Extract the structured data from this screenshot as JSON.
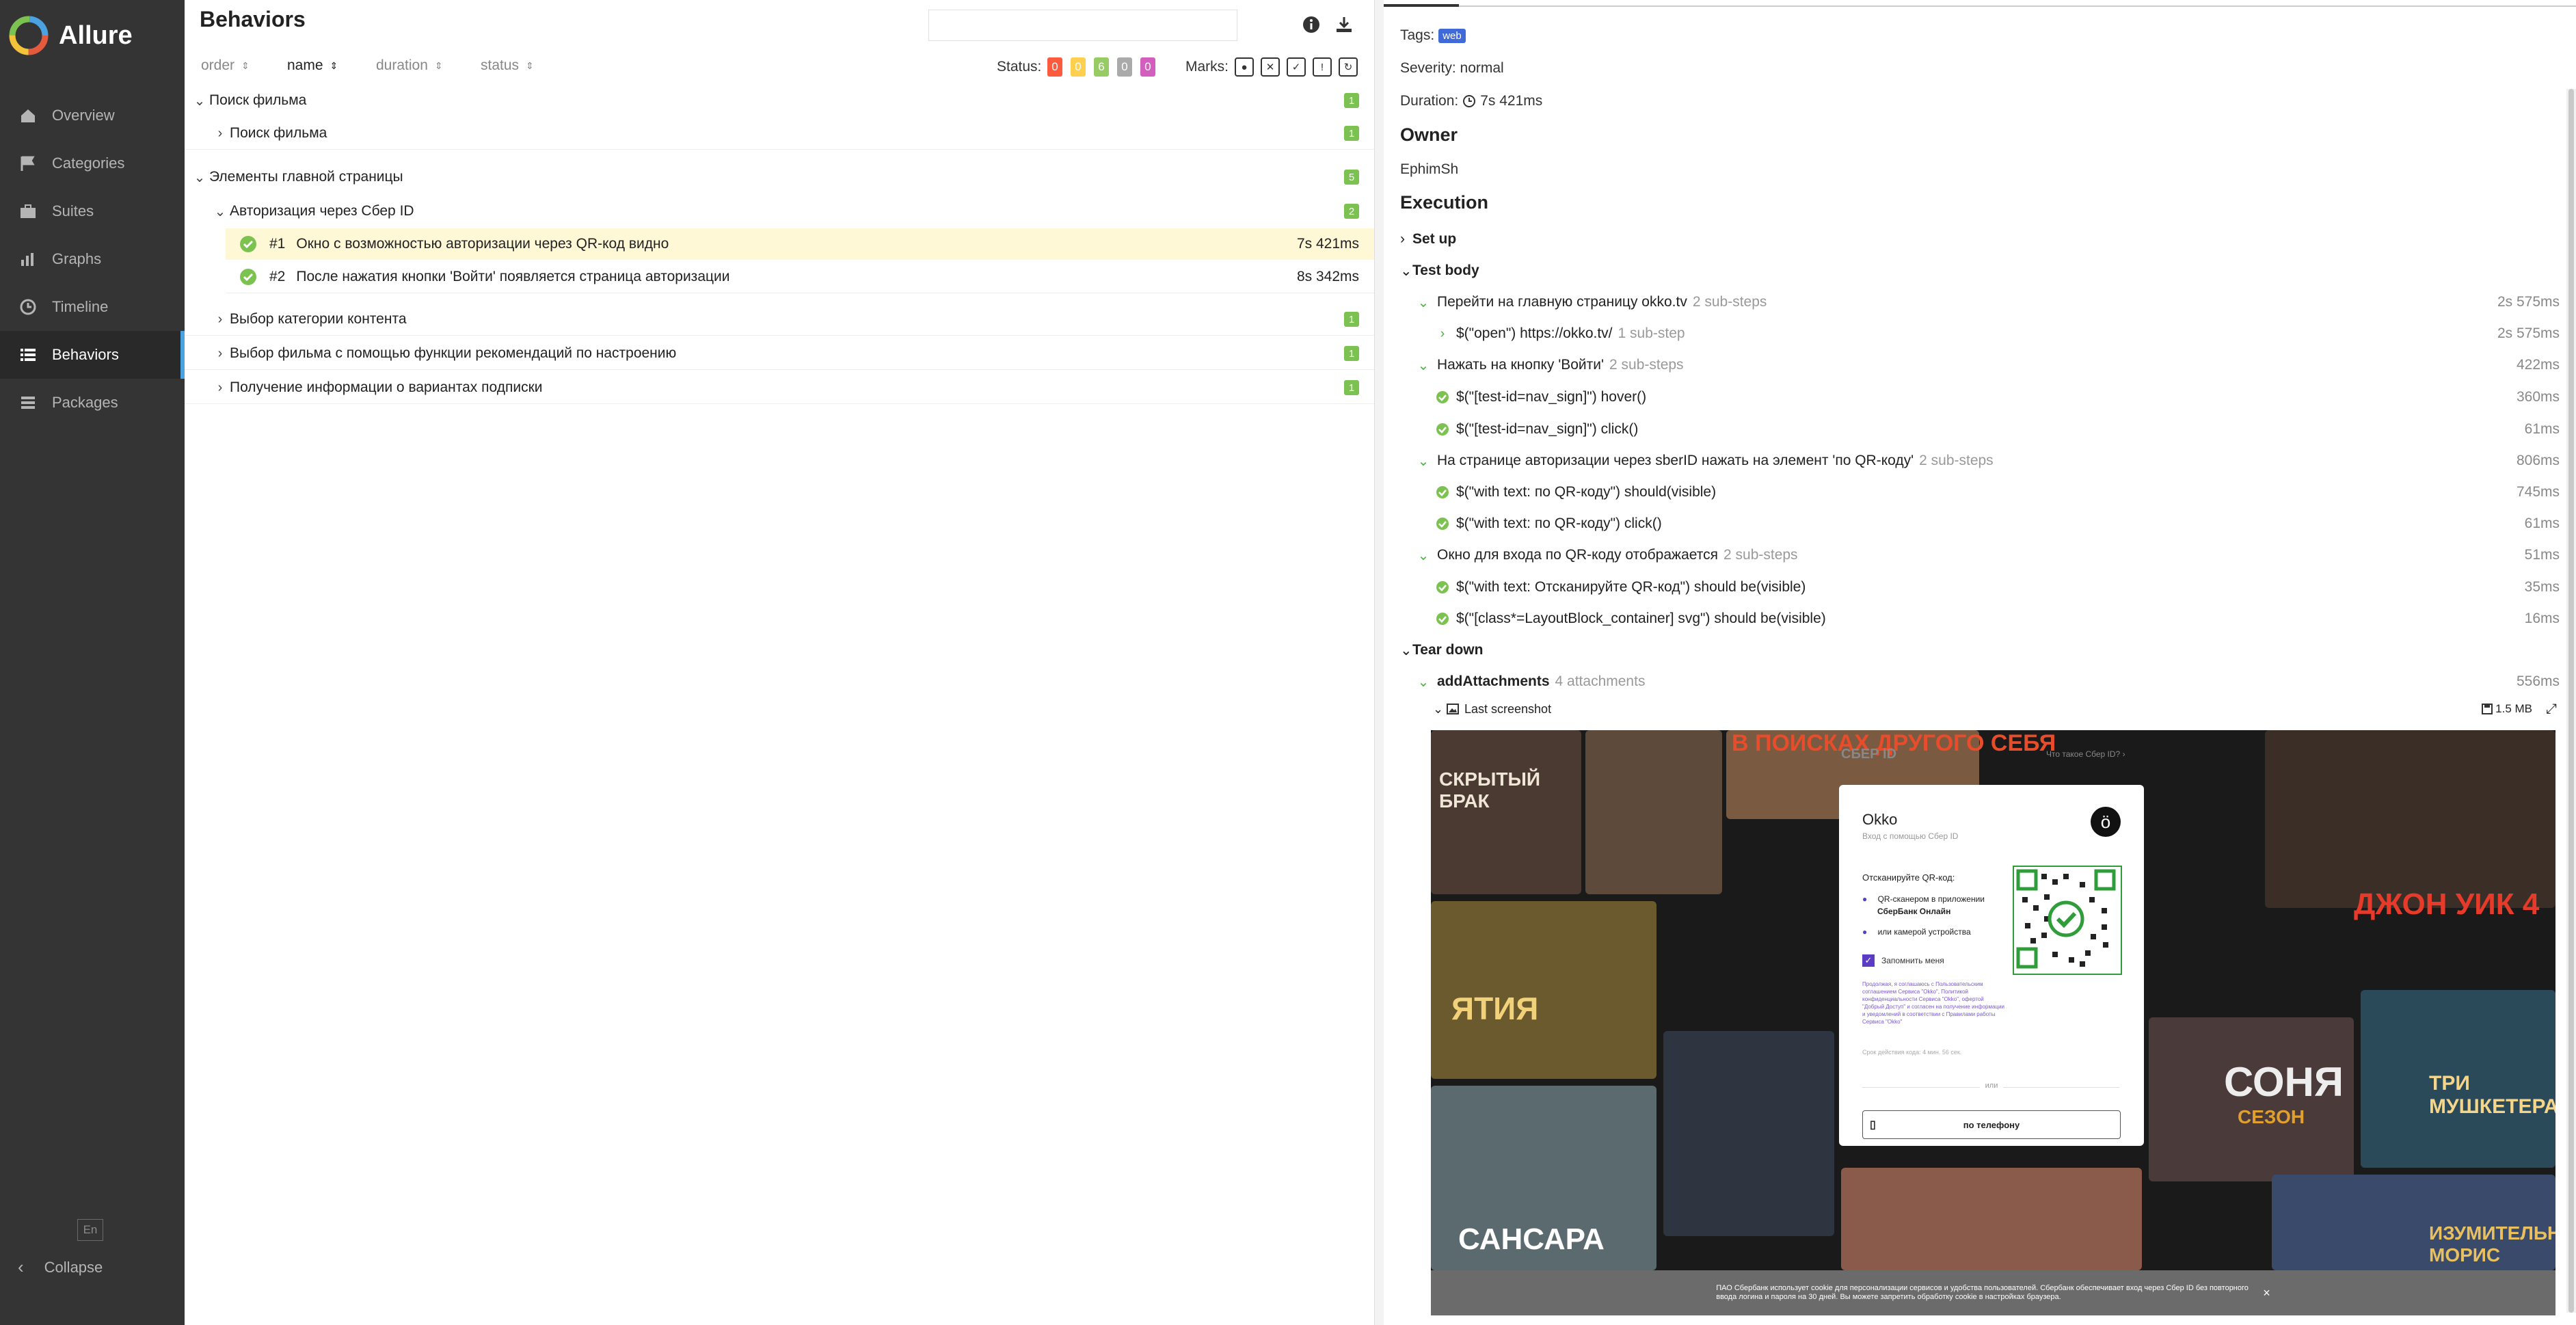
{
  "sidebar": {
    "brand": "Allure",
    "items": [
      {
        "label": "Overview",
        "icon": "overview-icon"
      },
      {
        "label": "Categories",
        "icon": "flag-icon"
      },
      {
        "label": "Suites",
        "icon": "briefcase-icon"
      },
      {
        "label": "Graphs",
        "icon": "bar-chart-icon"
      },
      {
        "label": "Timeline",
        "icon": "clock-icon"
      },
      {
        "label": "Behaviors",
        "icon": "list-icon",
        "active": true
      },
      {
        "label": "Packages",
        "icon": "stack-icon"
      }
    ],
    "lang": "En",
    "collapse": "Collapse"
  },
  "list": {
    "title": "Behaviors",
    "sort": {
      "order": "order",
      "name": "name",
      "duration": "duration",
      "status": "status"
    },
    "status_label": "Status:",
    "status_counts": [
      {
        "value": "0",
        "color": "#fd5a3e"
      },
      {
        "value": "0",
        "color": "#ffd050"
      },
      {
        "value": "6",
        "color": "#97cc64"
      },
      {
        "value": "0",
        "color": "#aaaaaa"
      },
      {
        "value": "0",
        "color": "#d35ebe"
      }
    ],
    "marks_label": "Marks:",
    "rows": [
      {
        "label": "Поиск фильма",
        "count": "1"
      },
      {
        "label": "Поиск фильма",
        "count": "1"
      },
      {
        "label": "Элементы главной страницы",
        "count": "5"
      },
      {
        "label": "Авторизация через Сбер ID",
        "count": "2"
      },
      {
        "num": "#1",
        "label": "Окно с возможностью авторизации через QR-код видно",
        "duration": "7s 421ms"
      },
      {
        "num": "#2",
        "label": "После нажатия кнопки 'Войти' появляется страница авторизации",
        "duration": "8s 342ms"
      },
      {
        "label": "Выбор категории контента",
        "count": "1"
      },
      {
        "label": "Выбор фильма с помощью функции рекомендаций по настроению",
        "count": "1"
      },
      {
        "label": "Получение информации о вариантах подписки",
        "count": "1"
      }
    ]
  },
  "detail": {
    "tags_label": "Tags:",
    "tag": "web",
    "severity": "Severity: normal",
    "duration_label": "Duration:",
    "duration": "7s 421ms",
    "owner_title": "Owner",
    "owner": "EphimSh",
    "execution_title": "Execution",
    "setup": "Set up",
    "test_body": "Test body",
    "teardown": "Tear down",
    "steps": [
      {
        "label": "Перейти на главную страницу okko.tv",
        "sub": "2 sub-steps",
        "time": "2s 575ms"
      },
      {
        "label": "$(\"open\")  https://okko.tv/",
        "sub": "1 sub-step",
        "time": "2s 575ms"
      },
      {
        "label": "Нажать на кнопку 'Войти'",
        "sub": "2 sub-steps",
        "time": "422ms"
      },
      {
        "label": "$(\"[test-id=nav_sign]\") hover()",
        "sub": "",
        "time": "360ms"
      },
      {
        "label": "$(\"[test-id=nav_sign]\") click()",
        "sub": "",
        "time": "61ms"
      },
      {
        "label": "На странице авторизации через sberID нажать на элемент 'по QR-коду'",
        "sub": "2 sub-steps",
        "time": "806ms"
      },
      {
        "label": "$(\"with text: по QR-коду\") should(visible)",
        "sub": "",
        "time": "745ms"
      },
      {
        "label": "$(\"with text: по QR-коду\") click()",
        "sub": "",
        "time": "61ms"
      },
      {
        "label": "Окно для входа по QR-коду отображается",
        "sub": "2 sub-steps",
        "time": "51ms"
      },
      {
        "label": "$(\"with text: Отсканируйте QR-код\") should be(visible)",
        "sub": "",
        "time": "35ms"
      },
      {
        "label": "$(\"[class*=LayoutBlock_container] svg\") should be(visible)",
        "sub": "",
        "time": "16ms"
      }
    ],
    "attach": {
      "label": "addAttachments",
      "sub": "4 attachments",
      "time": "556ms"
    },
    "screenshot": {
      "label": "Last screenshot",
      "size": "1.5 MB"
    },
    "mock": {
      "header_brand": "СБЕР ID",
      "header_link": "Что такое Сбер ID? ›",
      "app": "Okko",
      "subtitle": "Вход с помощью Сбер ID",
      "scan": "Отсканируйте QR-код:",
      "opt1a": "QR-сканером в приложении",
      "opt1b": "СберБанк Онлайн",
      "opt2": "или камерой устройства",
      "remember": "Запомнить меня",
      "legal": "Продолжая, я соглашаюсь с Пользовательским соглашением Сервиса \"Okko\", Политикой конфиденциальности Сервиса \"Okko\", офертой \"Добрый Доступ\" и согласен на получение информации и уведомлений в соответствии с Правилами работы Сервиса \"Okko\"",
      "timer": "Срок действия кода: 4 мин. 56 сек.",
      "or": "или",
      "phone": "по телефону",
      "posters": [
        "СКРЫТЫЙ БРАК",
        "В ПОИСКАХ ДРУГОГО СЕБЯ",
        "ДЖОН УИК 4",
        "ЯТИЯ",
        "СОНЯ",
        "СЕЗОН",
        "ТРИ МУШКЕТЕРА",
        "САНСАРА",
        "ИЗУМИТЕЛЬНЫЕ МОРИС"
      ],
      "cookie": "ПАО Сбербанк использует cookie для персонализации сервисов и удобства пользователей. Сбербанк обеспечивает вход через Сбер ID без повторного ввода логина и пароля на 30 дней. Вы можете запретить обработку cookie в настройках браузера."
    }
  }
}
